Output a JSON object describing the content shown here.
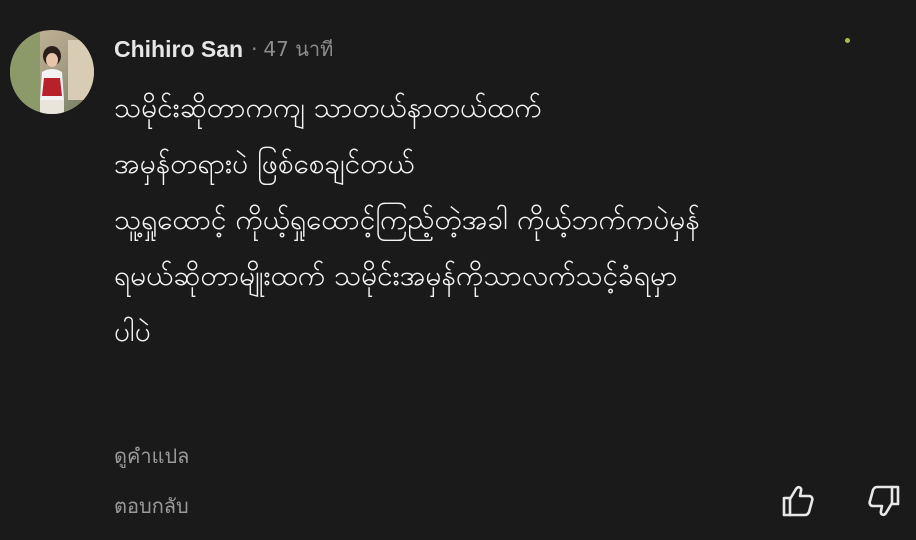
{
  "comment": {
    "author": "Chihiro San",
    "separator": "·",
    "time": "47 นาที",
    "lines": [
      "သမိုင်းဆိုတာကကျ သာတယ်နာတယ်ထက်",
      "အမှန်တရားပဲ ဖြစ်စေချင်တယ်",
      "သူ့ရှုထောင့် ကိုယ့်ရှုထောင့်ကြည့်တဲ့အခါ ကိုယ့်ဘက်ကပဲမှန်",
      "ရမယ်ဆိုတာမျိုးထက် သမိုင်းအမှန်ကိုသာလက်သင့်ခံရမှာ",
      "ပါပဲ"
    ],
    "translate_label": "ดูคำแปล",
    "reply_label": "ตอบกลับ"
  },
  "icons": {
    "like": "thumbs-up-icon",
    "dislike": "thumbs-down-icon"
  },
  "colors": {
    "background": "#1a1a1a",
    "primary_text": "#f4f4f4",
    "secondary_text": "#9a9a9a"
  }
}
